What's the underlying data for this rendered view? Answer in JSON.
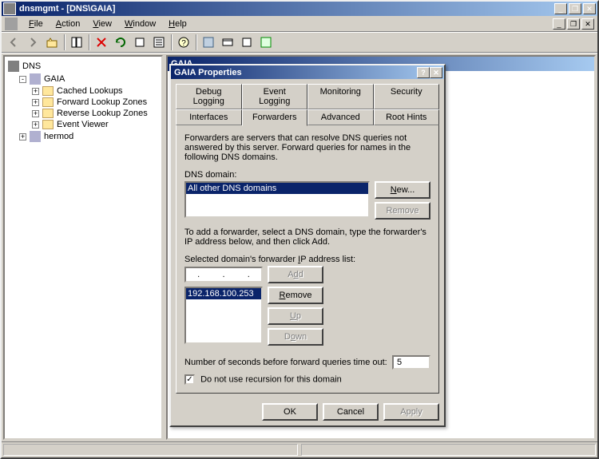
{
  "window": {
    "title": "dnsmgmt - [DNS\\GAIA]"
  },
  "menu": {
    "file": "File",
    "action": "Action",
    "view": "View",
    "window": "Window",
    "help": "Help"
  },
  "toolbar": {
    "back": "back",
    "forward": "forward",
    "up": "up",
    "show_hide": "show-hide",
    "delete": "delete",
    "refresh": "refresh",
    "export": "export",
    "properties": "properties",
    "help": "help",
    "i1": "icon",
    "i2": "icon",
    "i3": "icon",
    "i4": "icon"
  },
  "tree": {
    "root": "DNS",
    "server1": "GAIA",
    "cached": "Cached Lookups",
    "fwd": "Forward Lookup Zones",
    "rev": "Reverse Lookup Zones",
    "event": "Event Viewer",
    "server2": "hermod"
  },
  "child": {
    "title": "GAIA"
  },
  "dialog": {
    "title": "GAIA Properties",
    "tabs": {
      "debug": "Debug Logging",
      "event": "Event Logging",
      "monitoring": "Monitoring",
      "security": "Security",
      "interfaces": "Interfaces",
      "forwarders": "Forwarders",
      "advanced": "Advanced",
      "roothints": "Root Hints"
    },
    "desc": "Forwarders are servers that can resolve DNS queries not answered by this server. Forward queries for names in the following DNS domains.",
    "domain_label": "DNS domain:",
    "domain_all": "All other DNS domains",
    "new_btn": "New...",
    "remove_btn": "Remove",
    "add_hint": "To add a forwarder, select a DNS domain, type the forwarder's IP address below, and then click Add.",
    "ip_label": "Selected domain's forwarder IP address list:",
    "add_btn": "Add",
    "remove2_btn": "Remove",
    "up_btn": "Up",
    "down_btn": "Down",
    "fwd_ip": "192.168.100.253",
    "timeout_label": "Number of seconds before forward queries time out:",
    "timeout_value": "5",
    "no_recursion": "Do not use recursion for this domain",
    "ok": "OK",
    "cancel": "Cancel",
    "apply": "Apply"
  }
}
